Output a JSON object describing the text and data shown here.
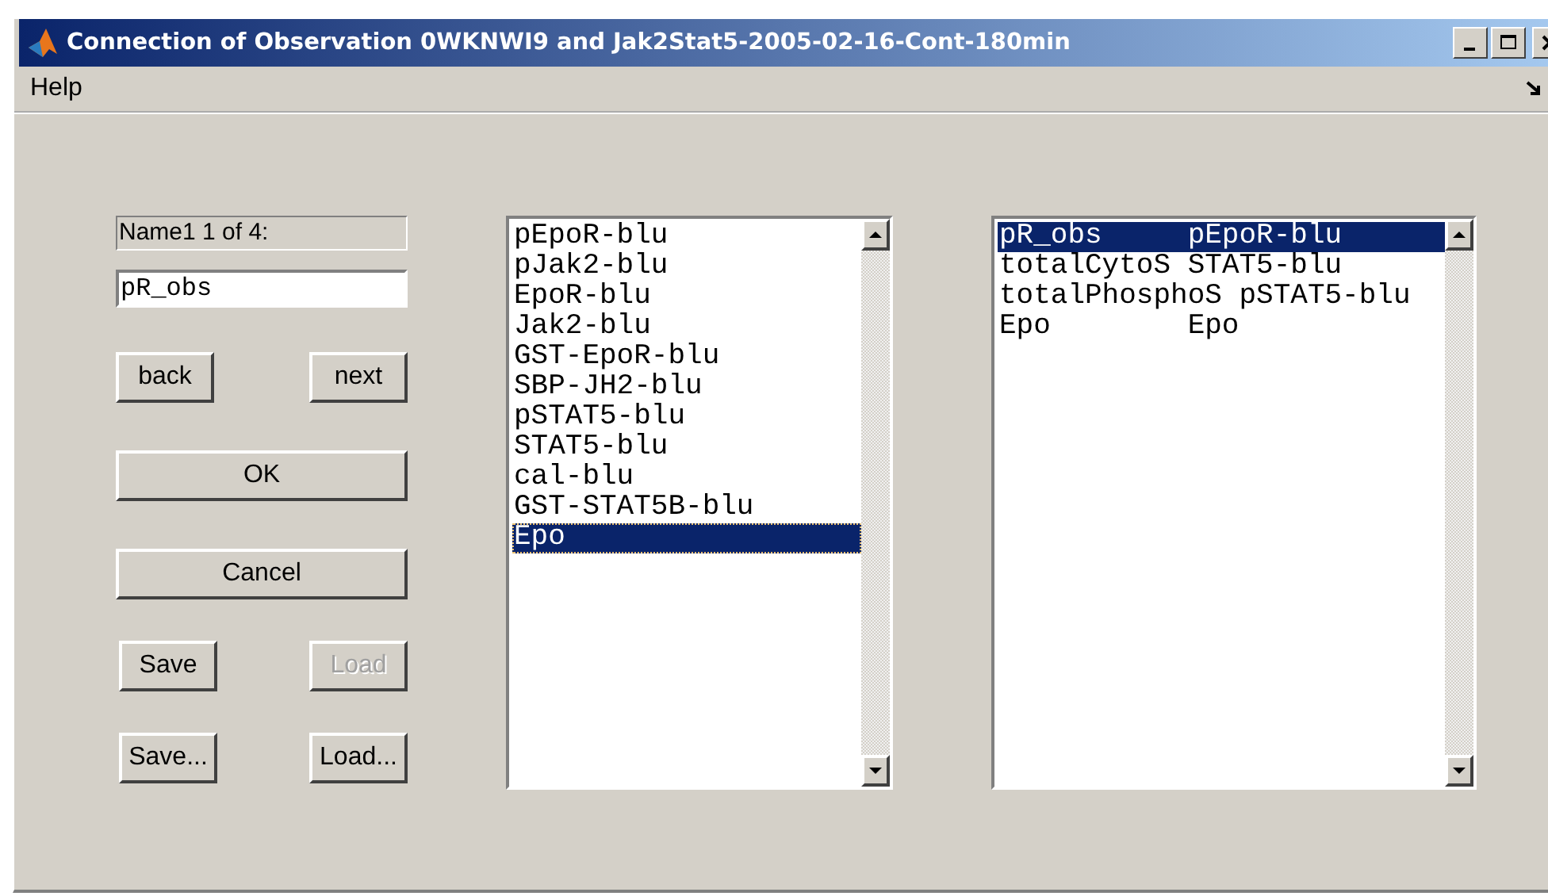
{
  "window": {
    "title": "Connection of Observation 0WKNWI9 and Jak2Stat5-2005-02-16-Cont-180min"
  },
  "menu": [
    "Help"
  ],
  "form": {
    "name_label": "Name1 1 of 4:",
    "name_value": "pR_obs",
    "button_rows": [
      [
        {
          "label": "back",
          "disabled": false
        },
        {
          "label": "next",
          "disabled": false
        }
      ],
      [
        {
          "label": "OK",
          "disabled": false
        }
      ],
      [
        {
          "label": "Cancel",
          "disabled": false
        }
      ],
      [
        {
          "label": "Save",
          "disabled": false
        },
        {
          "label": "Load",
          "disabled": true
        }
      ],
      [
        {
          "label": "Save...",
          "disabled": false
        },
        {
          "label": "Load...",
          "disabled": false
        }
      ]
    ]
  },
  "species_list": {
    "items": [
      {
        "label": "pEpoR-blu",
        "selected": false
      },
      {
        "label": "pJak2-blu",
        "selected": false
      },
      {
        "label": "EpoR-blu",
        "selected": false
      },
      {
        "label": "Jak2-blu",
        "selected": false
      },
      {
        "label": "GST-EpoR-blu",
        "selected": false
      },
      {
        "label": "SBP-JH2-blu",
        "selected": false
      },
      {
        "label": "pSTAT5-blu",
        "selected": false
      },
      {
        "label": "STAT5-blu",
        "selected": false
      },
      {
        "label": "cal-blu",
        "selected": false
      },
      {
        "label": "GST-STAT5B-blu",
        "selected": false
      },
      {
        "label": "Epo",
        "selected": true
      }
    ]
  },
  "mapping_list": {
    "rows": [
      {
        "column_1": "pR_obs",
        "column_2": "pEpoR-blu",
        "selected": true
      },
      {
        "column_1": "totalCytoS",
        "column_2": "STAT5-blu",
        "selected": false
      },
      {
        "column_1": "totalPhosphoS",
        "column_2": "pSTAT5-blu",
        "selected": false
      },
      {
        "column_1": "Epo",
        "column_2": "Epo",
        "selected": false
      }
    ]
  }
}
